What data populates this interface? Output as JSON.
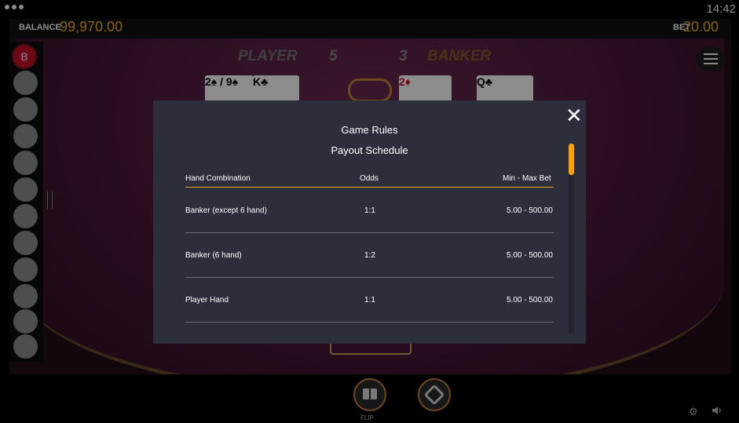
{
  "status": {
    "time": "14:42"
  },
  "account": {
    "balance_label": "BALANCE",
    "balance_value": "99,970.00",
    "bet_label": "BET",
    "bet_value": "20.00"
  },
  "roadmap": {
    "first_result": "B",
    "empty_slots": 11
  },
  "scoreboard": {
    "player_label": "PLAYER",
    "player_score": "5",
    "banker_score": "3",
    "banker_label": "BANKER"
  },
  "cards": {
    "player": [
      "2♠ / 9♠",
      "K♣"
    ],
    "banker": [
      "2♦",
      "Q♣"
    ]
  },
  "controls": {
    "flip_label": "FLIP"
  },
  "modal": {
    "title": "Game Rules",
    "subtitle": "Payout Schedule",
    "columns": [
      "Hand Combination",
      "Odds",
      "Min - Max Bet"
    ],
    "rows": [
      {
        "hand": "Banker (except 6 hand)",
        "odds": "1:1",
        "bet": "5.00 - 500.00"
      },
      {
        "hand": "Banker (6 hand)",
        "odds": "1:2",
        "bet": "5.00 - 500.00"
      },
      {
        "hand": "Player Hand",
        "odds": "1:1",
        "bet": "5.00 - 500.00"
      }
    ]
  },
  "colors": {
    "accent": "#f2a31e",
    "balance": "#f2b233",
    "modal_bg": "#2c2f3b",
    "banker_label": "#8a5a2a",
    "player_label": "#777777"
  },
  "icons": {
    "close": "close-icon",
    "menu": "hamburger-menu-icon",
    "settings": "gear-icon",
    "sound": "speaker-icon",
    "flip": "flip-cards-icon",
    "auto": "auto-play-icon"
  }
}
